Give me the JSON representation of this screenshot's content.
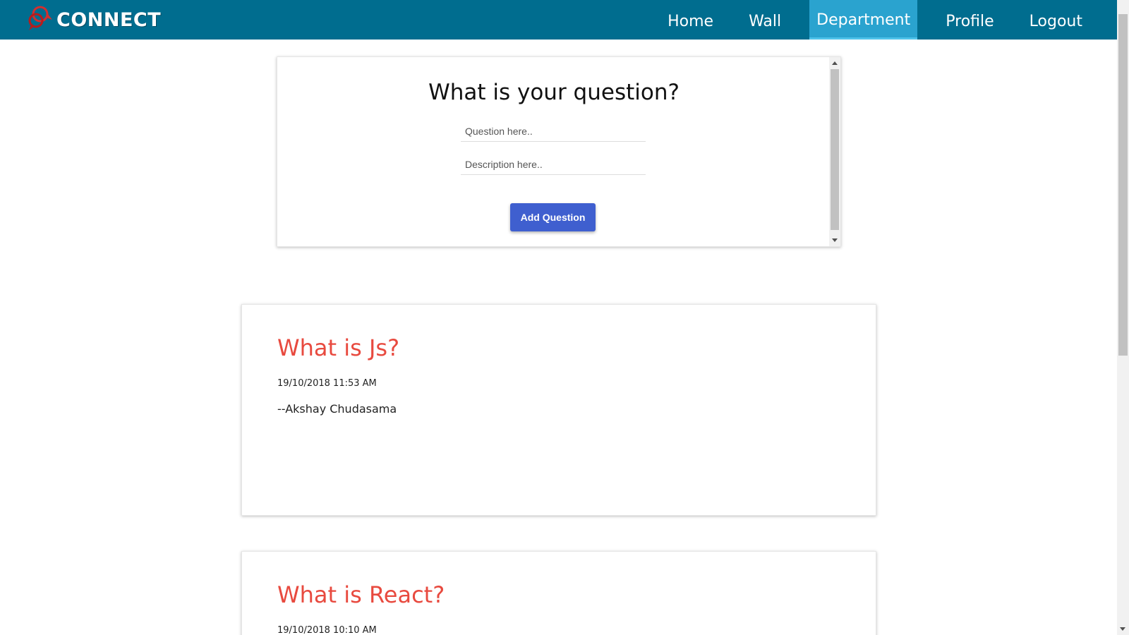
{
  "app": {
    "logo_text": "CONNECT"
  },
  "nav": {
    "items": [
      {
        "label": "Home"
      },
      {
        "label": "Wall"
      },
      {
        "label": "Department"
      },
      {
        "label": "Profile"
      },
      {
        "label": "Logout"
      }
    ],
    "active": "Department"
  },
  "form": {
    "title": "What is your question?",
    "question_placeholder": "Question here..",
    "description_placeholder": "Description here..",
    "submit_label": "Add Question"
  },
  "posts": [
    {
      "title": "What is Js?",
      "date": "19/10/2018 11:53 AM",
      "author": "--Akshay Chudasama"
    },
    {
      "title": "What is React?",
      "date": "19/10/2018 10:10 AM"
    }
  ],
  "colors": {
    "navbar": "#006d8f",
    "nav_active": "#2aa3cf",
    "button": "#3f5fcf",
    "post_title": "#e84a3f",
    "logo_icon": "#d32f2f"
  }
}
